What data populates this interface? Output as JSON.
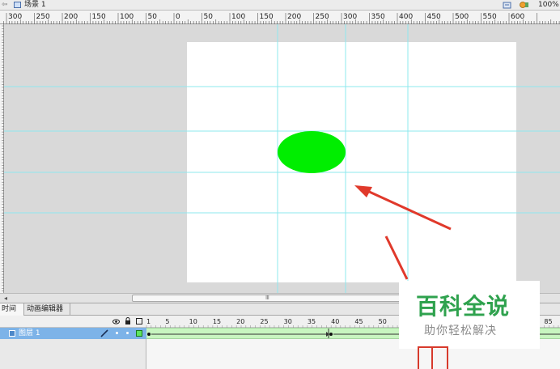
{
  "scene": {
    "back_icon": "left-arrow-icon",
    "scene_icon": "clapperboard-icon",
    "label": "场景 1",
    "edit_icon": "edit-scene-icon",
    "symbol_icon": "edit-symbol-icon",
    "zoom": "100%"
  },
  "ruler": {
    "labels": [
      "300",
      "250",
      "200",
      "150",
      "100",
      "50",
      "0",
      "50",
      "100",
      "150",
      "200",
      "250",
      "300",
      "350",
      "400",
      "450",
      "500",
      "550",
      "600"
    ]
  },
  "stage": {
    "background": "#d9d9d9",
    "canvas_color": "#ffffff",
    "guide_color": "#8ee8ee",
    "shape": {
      "type": "ellipse",
      "fill": "#00ee00"
    },
    "annotation_color": "#e0392b"
  },
  "scrollbar": {
    "grip": "Ⅲ",
    "left_arrow": "◂"
  },
  "timeline": {
    "tabs": [
      {
        "label": "时间轴",
        "active": true
      },
      {
        "label": "动画编辑器",
        "active": false
      }
    ],
    "header_icons": [
      "eye-icon",
      "lock-icon",
      "outline-icon"
    ],
    "frame_numbers": [
      "1",
      "5",
      "10",
      "15",
      "20",
      "25",
      "30",
      "35",
      "40",
      "45",
      "50",
      "85"
    ],
    "layers": [
      {
        "name": "图层 1",
        "selected": true,
        "tween_color": "#c8f5c0"
      }
    ]
  },
  "watermark": {
    "title": "百科全说",
    "subtitle": "助你轻松解决",
    "title_color": "#2fa24e"
  }
}
